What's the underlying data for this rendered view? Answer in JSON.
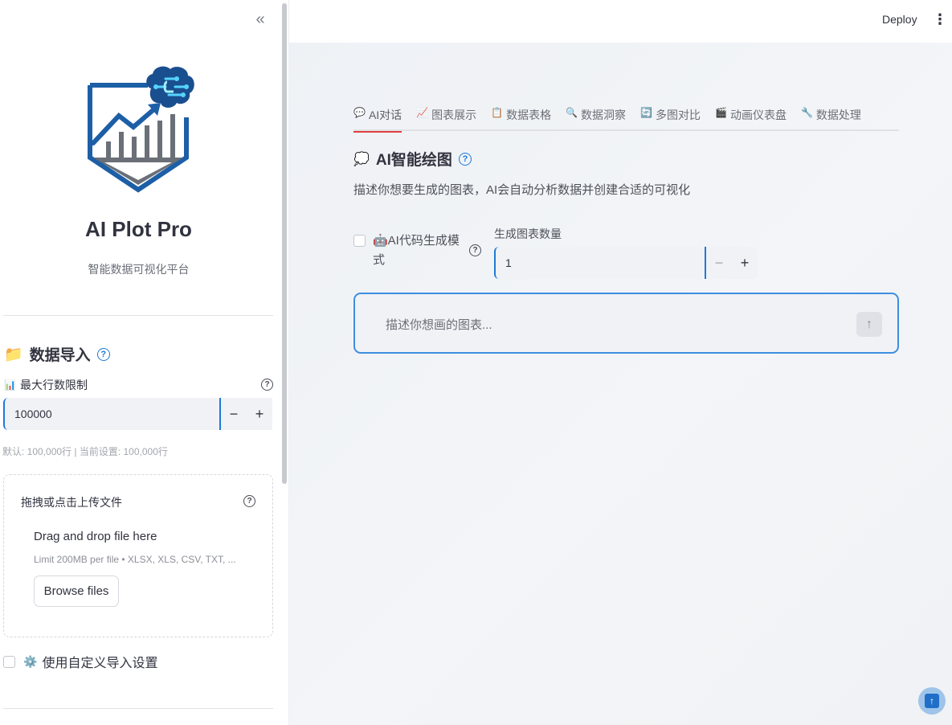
{
  "sidebar": {
    "collapse_glyph": "«",
    "app_title": "AI Plot Pro",
    "app_subtitle": "智能数据可视化平台",
    "section_title": "数据导入",
    "section_icon": "📁",
    "max_rows": {
      "icon": "📊",
      "label": "最大行数限制",
      "value": "100000",
      "minus": "−",
      "plus": "+",
      "hint": "默认: 100,000行 | 当前设置: 100,000行"
    },
    "uploader": {
      "label": "拖拽或点击上传文件",
      "drag_text": "Drag and drop file here",
      "limit_text": "Limit 200MB per file • XLSX, XLS, CSV, TXT, ...",
      "browse_label": "Browse files"
    },
    "custom_import": {
      "icon": "⚙️",
      "label": "使用自定义导入设置",
      "checked": false
    }
  },
  "header": {
    "deploy_label": "Deploy",
    "menu_glyph": "⋮"
  },
  "main": {
    "tabs": [
      {
        "icon": "💬",
        "label": "AI对话",
        "active": true
      },
      {
        "icon": "📈",
        "label": "图表展示",
        "active": false
      },
      {
        "icon": "📋",
        "label": "数据表格",
        "active": false
      },
      {
        "icon": "🔍",
        "label": "数据洞察",
        "active": false
      },
      {
        "icon": "🔄",
        "label": "多图对比",
        "active": false
      },
      {
        "icon": "🎬",
        "label": "动画仪表盘",
        "active": false
      },
      {
        "icon": "🔧",
        "label": "数据处理",
        "active": false
      }
    ],
    "heading_icon": "💭",
    "heading": "AI智能绘图",
    "description": "描述你想要生成的图表，AI会自动分析数据并创建合适的可视化",
    "ai_code_mode": {
      "label": "🤖AI代码生成模式",
      "checked": false
    },
    "chart_count": {
      "label": "生成图表数量",
      "value": "1",
      "minus": "−",
      "plus": "+"
    },
    "chat_placeholder": "描述你想画的图表...",
    "send_glyph": "↑"
  },
  "colors": {
    "accent_blue": "#1f7ad6",
    "tab_active_underline": "#e03f3f",
    "main_bg": "#eef1f5"
  }
}
